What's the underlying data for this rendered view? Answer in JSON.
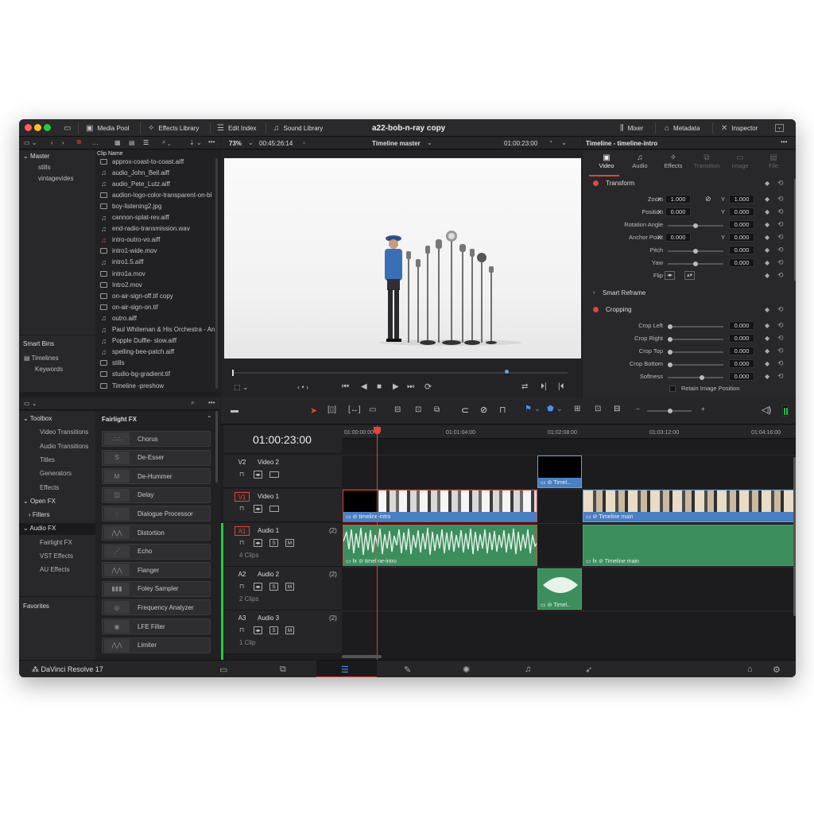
{
  "window": {
    "title": "a22-bob-n-ray copy"
  },
  "toolbar": {
    "media_pool": "Media Pool",
    "effects_library": "Effects Library",
    "edit_index": "Edit Index",
    "sound_library": "Sound Library",
    "mixer": "Mixer",
    "metadata": "Metadata",
    "inspector": "Inspector"
  },
  "viewer": {
    "zoom": "73%",
    "source_timecode": "00:45:26:14",
    "name": "Timeline master",
    "timecode": "01:00:23:00"
  },
  "bins": {
    "master": "Master",
    "items": [
      "stills",
      "vintagevides"
    ],
    "smart_bins": "Smart Bins",
    "smart_items": [
      "Timelines",
      "Keywords"
    ]
  },
  "clips": {
    "header": "Clip Name",
    "items": [
      "approx-coast-to-coast.aiff",
      "audio_John_Bell.aiff",
      "audio_Pete_Lutz.aiff",
      "audion-logo-color-transparent-on-bl",
      "boy-listening2.jpg",
      "cannon-splat-rev.aiff",
      "end-radio-transmission.wav",
      "intro-outro-vo.aiff",
      "intro1-wide.mov",
      "intro1.5.aiff",
      "intro1a.mov",
      "Intro2.mov",
      "on-air-sign-off.tif copy",
      "on-air-sign-on.tif",
      "outro.aiff",
      "Paul Whiteman & His Orchestra - An",
      "Popple Duffle- slow.aiff",
      "spelling-bee-patch.aiff",
      "stills",
      "studio-bg-gradient.tif",
      "Timeline -preshow"
    ]
  },
  "toolbox": {
    "items": [
      "Toolbox",
      "Video Transitions",
      "Audio Transitions",
      "Titles",
      "Generators",
      "Effects",
      "Open FX",
      "Filters",
      "Audio FX",
      "Fairlight FX",
      "VST Effects",
      "AU Effects"
    ],
    "favorites": "Favorites"
  },
  "fairlight": {
    "header": "Fairlight FX",
    "items": [
      "Chorus",
      "De-Esser",
      "De-Hummer",
      "Delay",
      "Dialogue Processor",
      "Distortion",
      "Echo",
      "Flanger",
      "Foley Sampler",
      "Frequency Analyzer",
      "LFE Filter",
      "Limiter"
    ]
  },
  "inspector": {
    "title": "Timeline - timeline-intro",
    "tabs": [
      "Video",
      "Audio",
      "Effects",
      "Transition",
      "Image",
      "File"
    ],
    "transform": "Transform",
    "zoom_label": "Zoom",
    "zoom_x": "1.000",
    "zoom_y": "1.000",
    "position_label": "Position",
    "pos_x": "0.000",
    "pos_y": "0.000",
    "rotation_label": "Rotation Angle",
    "rotation": "0.000",
    "anchor_label": "Anchor Point",
    "anchor_x": "0.000",
    "anchor_y": "0.000",
    "pitch_label": "Pitch",
    "pitch": "0.000",
    "yaw_label": "Yaw",
    "yaw": "0.000",
    "flip_label": "Flip",
    "smart_reframe": "Smart Reframe",
    "cropping": "Cropping",
    "crop_left_label": "Crop Left",
    "crop_left": "0.000",
    "crop_right_label": "Crop Right",
    "crop_right": "0.000",
    "crop_top_label": "Crop Top",
    "crop_top": "0.000",
    "crop_bottom_label": "Crop Bottom",
    "crop_bottom": "0.000",
    "softness_label": "Softness",
    "softness": "0.000",
    "retain": "Retain Image Position",
    "x": "X",
    "y": "Y"
  },
  "timeline": {
    "timecode": "01:00:23:00",
    "ruler": [
      "01:00:00:00",
      "01:01:04:00",
      "01:02:08:00",
      "01:03:12:00",
      "01:04:16:00"
    ],
    "tracks": [
      {
        "id": "V2",
        "name": "Video 2"
      },
      {
        "id": "V1",
        "name": "Video 1"
      },
      {
        "id": "A1",
        "name": "Audio 1",
        "count": "(2)",
        "clips": "4 Clips"
      },
      {
        "id": "A2",
        "name": "Audio 2",
        "count": "(2)",
        "clips": "2 Clips"
      },
      {
        "id": "A3",
        "name": "Audio 3",
        "count": "(2)",
        "clips": "1 Clip"
      }
    ],
    "clip_labels": {
      "v1a": "timeline-intro",
      "v1b": "Timeline main",
      "v2": "Timel...",
      "a1a": "timeline-intro",
      "a1b": "Timeline main",
      "a2": "Timel..."
    }
  },
  "app": {
    "name": "DaVinci Resolve 17"
  }
}
